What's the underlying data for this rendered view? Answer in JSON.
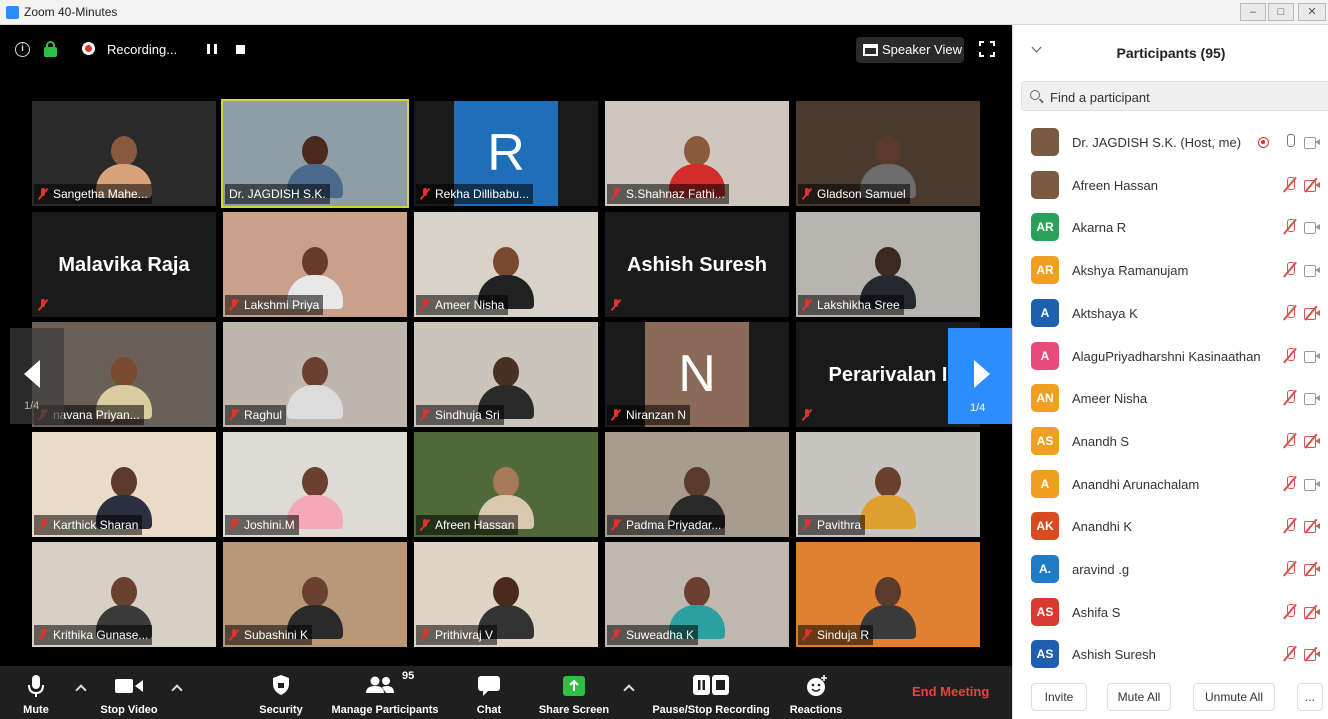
{
  "window": {
    "title": "Zoom 40-Minutes"
  },
  "topbar": {
    "recording_label": "Recording...",
    "speaker_view_label": "Speaker View"
  },
  "tiles": [
    {
      "name": "Sangetha Mahe...",
      "bg": "#2a2a2a",
      "skin": "#8a5a40",
      "shirt": "#d7a17a",
      "type": "video"
    },
    {
      "name": "Dr. JAGDISH S.K.",
      "bg": "#8f9ea6",
      "skin": "#4a2a1a",
      "shirt": "#4a6a8c",
      "type": "video",
      "active": true
    },
    {
      "name": "Rekha Dillibabu...",
      "type": "initial",
      "initial": "R",
      "color": "#1f6fb8"
    },
    {
      "name": "S.Shahnaz Fathi...",
      "bg": "#cfc7bd",
      "skin": "#8a5a3a",
      "shirt": "#d42b2b",
      "type": "video"
    },
    {
      "name": "Gladson Samuel",
      "bg": "#4a3a2e",
      "skin": "#5a3a2a",
      "shirt": "#6d6d6d",
      "type": "video"
    },
    {
      "name": "",
      "type": "text",
      "bigname": "Malavika Raja"
    },
    {
      "name": "Lakshmi Priya",
      "bg": "#c9a08c",
      "skin": "#6a3a2a",
      "shirt": "#e8e8e8",
      "type": "video"
    },
    {
      "name": "Ameer Nisha",
      "bg": "#d8d2c8",
      "skin": "#7a4a30",
      "shirt": "#222222",
      "type": "video"
    },
    {
      "name": "",
      "type": "text",
      "bigname": "Ashish Suresh"
    },
    {
      "name": "Lakshikha Sree",
      "bg": "#b8b4b0",
      "skin": "#3a2a22",
      "shirt": "#222a30",
      "type": "video"
    },
    {
      "name": "navana Priyan...",
      "bg": "#6a6058",
      "skin": "#7a4a30",
      "shirt": "#d9cda0",
      "type": "video"
    },
    {
      "name": "Raghul",
      "bg": "#bfb7ad",
      "skin": "#6a4030",
      "shirt": "#dcdcdc",
      "type": "video"
    },
    {
      "name": "Sindhuja Sri",
      "bg": "#cbc4bb",
      "skin": "#4a3024",
      "shirt": "#2a2a2a",
      "type": "video"
    },
    {
      "name": "Niranzan N",
      "type": "initial",
      "initial": "N",
      "color": "#8a6a58"
    },
    {
      "name": "",
      "type": "text",
      "bigname": "Perarivalan I"
    },
    {
      "name": "Karthick Sharan",
      "bg": "#e8dcc8",
      "skin": "#5a3a2a",
      "shirt": "#2a3040",
      "type": "video"
    },
    {
      "name": "Joshini.M",
      "bg": "#dedad4",
      "skin": "#6a4030",
      "shirt": "#f4a8b8",
      "type": "video"
    },
    {
      "name": "Afreen Hassan",
      "bg": "#4f6a38",
      "skin": "#a87858",
      "shirt": "#d8c8b0",
      "type": "video"
    },
    {
      "name": "Padma Priyadar...",
      "bg": "#a89c90",
      "skin": "#5a3a2a",
      "shirt": "#2a2a2a",
      "type": "video"
    },
    {
      "name": "Pavithra",
      "bg": "#c8c4c0",
      "skin": "#6a4030",
      "shirt": "#e0a030",
      "type": "video"
    },
    {
      "name": "Krithika Gunase...",
      "bg": "#d8d0c4",
      "skin": "#6a4030",
      "shirt": "#3a3a3a",
      "type": "video"
    },
    {
      "name": "Subashini K",
      "bg": "#b89878",
      "skin": "#6a4030",
      "shirt": "#2a2a2a",
      "type": "video"
    },
    {
      "name": "Prithivraj V",
      "bg": "#e0d4c4",
      "skin": "#4a2a1a",
      "shirt": "#333333",
      "type": "video"
    },
    {
      "name": "Suweadha K",
      "bg": "#c0b8b0",
      "skin": "#6a4030",
      "shirt": "#2aa0a0",
      "type": "video"
    },
    {
      "name": "Sinduja R",
      "bg": "#e08030",
      "skin": "#5a3a2a",
      "shirt": "#3a3a3a",
      "type": "video"
    }
  ],
  "pager": {
    "left": "1/4",
    "right": "1/4"
  },
  "toolbar": {
    "mute": "Mute",
    "stop_video": "Stop Video",
    "security": "Security",
    "manage_participants": "Manage Participants",
    "participant_count": "95",
    "chat": "Chat",
    "share_screen": "Share Screen",
    "pause_stop_recording": "Pause/Stop Recording",
    "reactions": "Reactions",
    "end_meeting": "End Meeting"
  },
  "panel": {
    "title": "Participants (95)",
    "search_placeholder": "Find a participant",
    "participants": [
      {
        "name": "Dr. JAGDISH S.K. (Host, me)",
        "avatar": "photo",
        "mic": "on",
        "cam": "on",
        "recording": true
      },
      {
        "name": "Afreen Hassan",
        "avatar": "photo",
        "mic": "off",
        "cam": "off"
      },
      {
        "name": "Akarna R",
        "avatar": "AR",
        "color": "#2aa05a",
        "mic": "off",
        "cam": "on"
      },
      {
        "name": "Akshya Ramanujam",
        "avatar": "AR",
        "color": "#f0a020",
        "mic": "off",
        "cam": "on"
      },
      {
        "name": "Aktshaya K",
        "avatar": "A",
        "color": "#1f5fb0",
        "mic": "off",
        "cam": "off"
      },
      {
        "name": "AlaguPriyadharshni Kasinaathan",
        "avatar": "A",
        "color": "#e84a7a",
        "mic": "off",
        "cam": "on"
      },
      {
        "name": "Ameer Nisha",
        "avatar": "AN",
        "color": "#f0a020",
        "mic": "off",
        "cam": "on"
      },
      {
        "name": "Anandh S",
        "avatar": "AS",
        "color": "#f0a020",
        "mic": "off",
        "cam": "off"
      },
      {
        "name": "Anandhi Arunachalam",
        "avatar": "A",
        "color": "#f0a020",
        "mic": "off",
        "cam": "on"
      },
      {
        "name": "Anandhi K",
        "avatar": "AK",
        "color": "#d84a20",
        "mic": "off",
        "cam": "off"
      },
      {
        "name": "aravind .g",
        "avatar": "A.",
        "color": "#1f7ac8",
        "mic": "off",
        "cam": "off"
      },
      {
        "name": "Ashifa S",
        "avatar": "AS",
        "color": "#d83a30",
        "mic": "off",
        "cam": "off"
      },
      {
        "name": "Ashish Suresh",
        "avatar": "AS",
        "color": "#1f5fb0",
        "mic": "off",
        "cam": "off"
      }
    ],
    "buttons": {
      "invite": "Invite",
      "mute_all": "Mute All",
      "unmute_all": "Unmute All",
      "more": "..."
    }
  }
}
